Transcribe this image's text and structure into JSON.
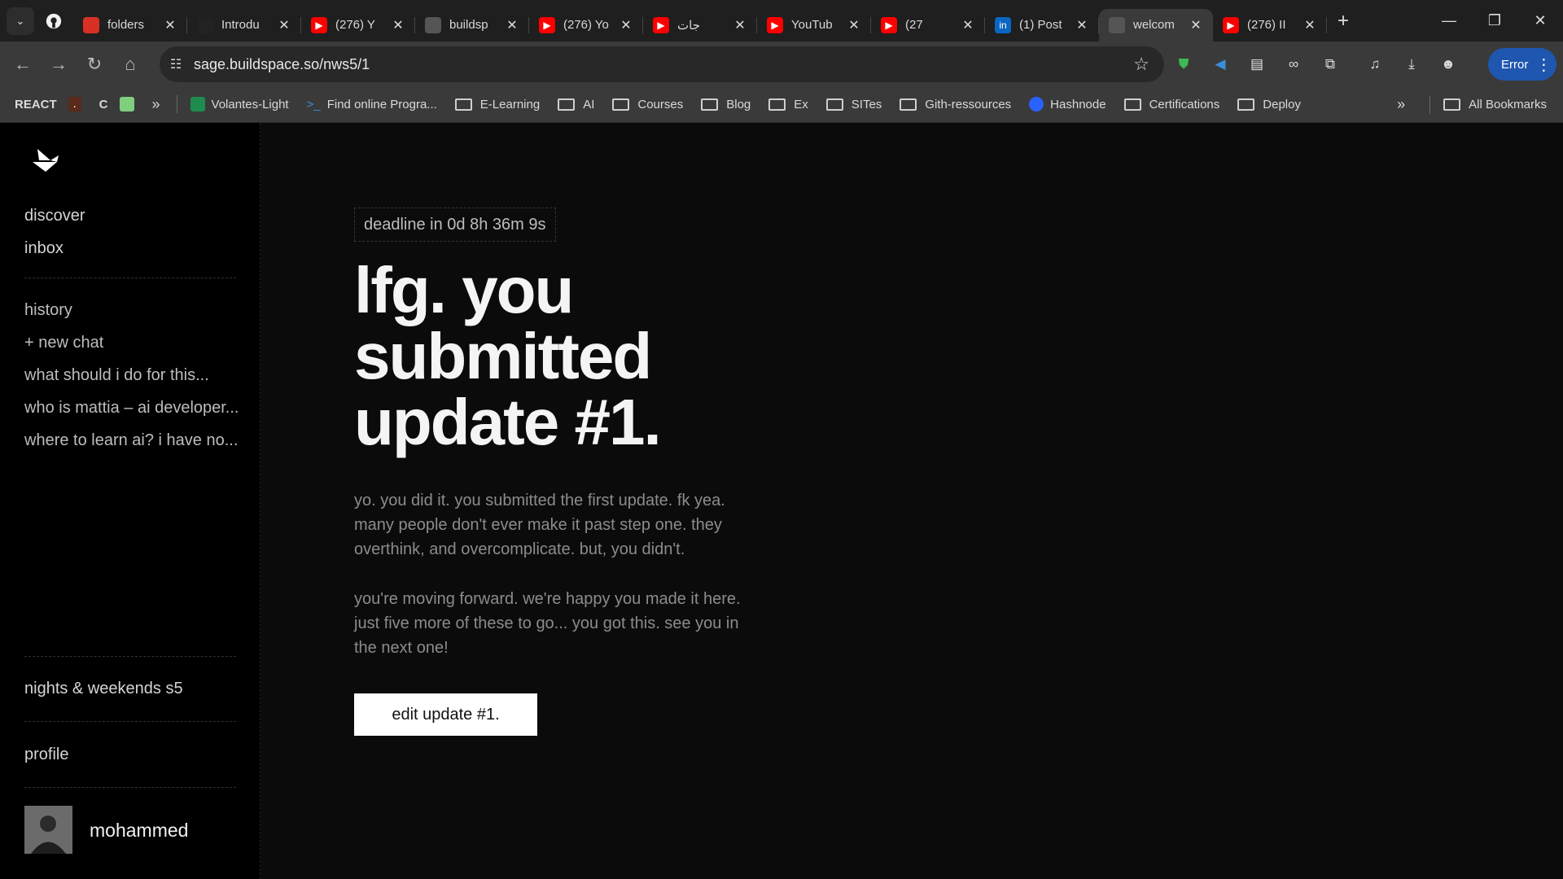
{
  "browser": {
    "tabs": [
      {
        "title": "folders",
        "favicon": "red-square-icon",
        "color": "#d93025"
      },
      {
        "title": "Introdu",
        "favicon": "terminal-icon",
        "color": "#222"
      },
      {
        "title": "(276) Y",
        "favicon": "youtube-icon",
        "color": "#ff0000"
      },
      {
        "title": "buildsp",
        "favicon": "buildspace-icon",
        "color": "#555"
      },
      {
        "title": "(276) Yo",
        "favicon": "youtube-icon",
        "color": "#ff0000"
      },
      {
        "title": "جات",
        "favicon": "youtube-icon",
        "color": "#ff0000"
      },
      {
        "title": "YouTub",
        "favicon": "youtube-icon",
        "color": "#ff0000"
      },
      {
        "title": "(27",
        "favicon": "youtube-icon",
        "color": "#ff0000"
      },
      {
        "title": "(1) Post",
        "favicon": "linkedin-icon",
        "color": "#0a66c2"
      },
      {
        "title": "welcom",
        "favicon": "buildspace-icon",
        "color": "#555"
      },
      {
        "title": "(276) II",
        "favicon": "youtube-icon",
        "color": "#ff0000"
      }
    ],
    "url": "sage.buildspace.so/nws5/1",
    "profile_label": "Error",
    "bookmarks": [
      {
        "label": "REACT",
        "type": "text"
      },
      {
        "label": ".",
        "type": "text"
      },
      {
        "label": "C",
        "type": "text"
      },
      {
        "label": "Volantes-Light",
        "type": "link"
      },
      {
        "label": "Find  online Progra...",
        "type": "link"
      },
      {
        "label": "E-Learning",
        "type": "folder"
      },
      {
        "label": "AI",
        "type": "folder"
      },
      {
        "label": "Courses",
        "type": "folder"
      },
      {
        "label": "Blog",
        "type": "folder"
      },
      {
        "label": "Ex",
        "type": "folder"
      },
      {
        "label": "SITes",
        "type": "folder"
      },
      {
        "label": "Gith-ressources",
        "type": "folder"
      },
      {
        "label": "Hashnode",
        "type": "link"
      },
      {
        "label": "Certifications",
        "type": "folder"
      },
      {
        "label": "Deploy",
        "type": "folder"
      }
    ],
    "all_bookmarks": "All Bookmarks"
  },
  "sidebar": {
    "discover": "discover",
    "inbox": "inbox",
    "history": "history",
    "new_chat": "+ new chat",
    "chats": [
      "what should i do for this...",
      "who is mattia – ai developer...",
      "where to learn ai? i have no..."
    ],
    "program": "nights & weekends s5",
    "profile": "profile",
    "username": "mohammed"
  },
  "main": {
    "deadline": "deadline in 0d 8h 36m 9s",
    "headline": "lfg. you submitted update #1.",
    "paragraph_1": "yo. you did it. you submitted the first update. fk yea. many people don't ever make it past step one. they overthink, and overcomplicate. but, you didn't.",
    "paragraph_2": "you're moving forward. we're happy you made it here. just five more of these to go... you got this. see you in the next one!",
    "edit_button": "edit update #1."
  }
}
